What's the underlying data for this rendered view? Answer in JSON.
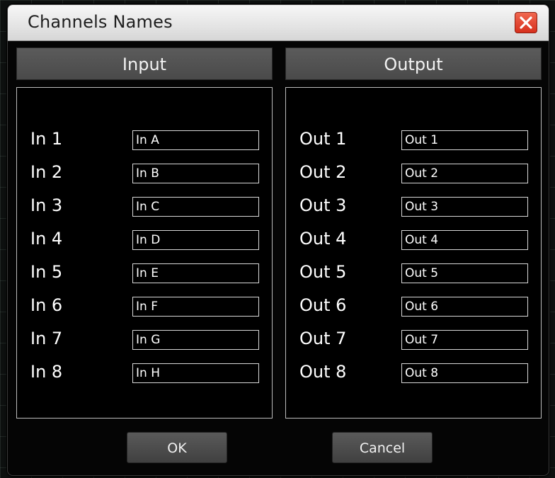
{
  "window": {
    "title": "Channels Names",
    "close_icon": "close-icon"
  },
  "input": {
    "header": "Input",
    "rows": [
      {
        "label": "In 1",
        "value": "In A"
      },
      {
        "label": "In 2",
        "value": "In B"
      },
      {
        "label": "In 3",
        "value": "In C"
      },
      {
        "label": "In 4",
        "value": "In D"
      },
      {
        "label": "In 5",
        "value": "In E"
      },
      {
        "label": "In 6",
        "value": "In F"
      },
      {
        "label": "In 7",
        "value": "In G"
      },
      {
        "label": "In 8",
        "value": "In H"
      }
    ]
  },
  "output": {
    "header": "Output",
    "rows": [
      {
        "label": "Out 1",
        "value": "Out 1"
      },
      {
        "label": "Out 2",
        "value": "Out 2"
      },
      {
        "label": "Out 3",
        "value": "Out 3"
      },
      {
        "label": "Out 4",
        "value": "Out 4"
      },
      {
        "label": "Out 5",
        "value": "Out 5"
      },
      {
        "label": "Out 6",
        "value": "Out 6"
      },
      {
        "label": "Out 7",
        "value": "Out 7"
      },
      {
        "label": "Out 8",
        "value": "Out 8"
      }
    ]
  },
  "buttons": {
    "ok_label": "OK",
    "cancel_label": "Cancel"
  },
  "colors": {
    "close_red": "#e0412b",
    "header_gray": "#525252"
  }
}
